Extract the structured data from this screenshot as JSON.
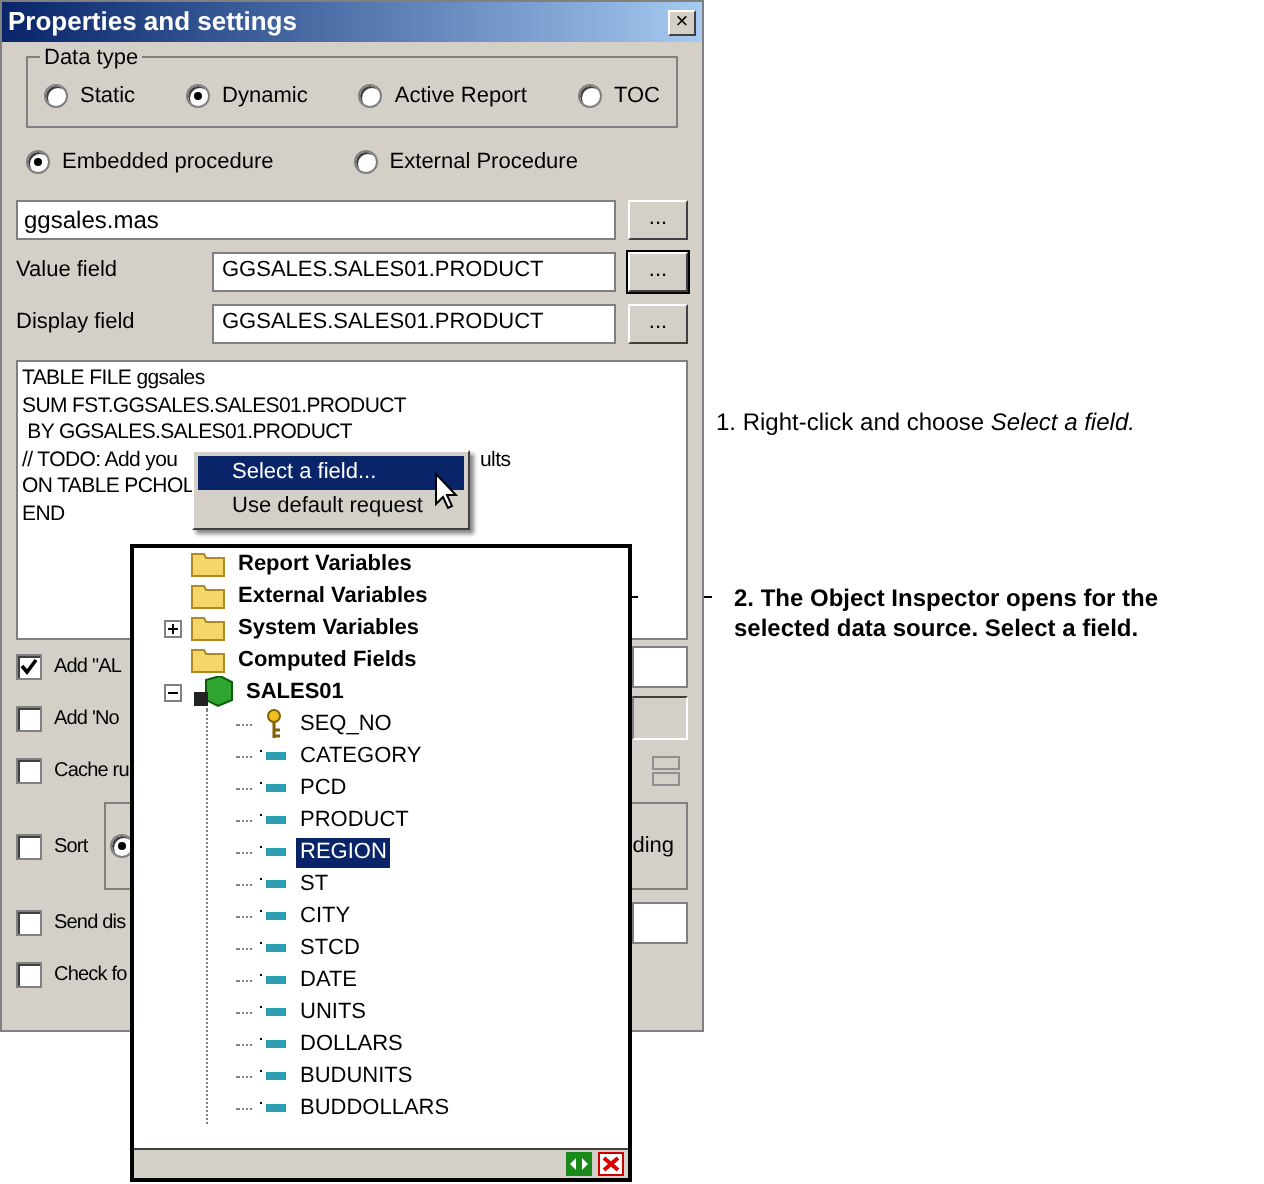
{
  "window": {
    "title": "Properties and settings",
    "close": "×"
  },
  "data_type": {
    "label": "Data type",
    "options": [
      {
        "label": "Static",
        "selected": false
      },
      {
        "label": "Dynamic",
        "selected": true
      },
      {
        "label": "Active Report",
        "selected": false
      },
      {
        "label": "TOC",
        "selected": false
      }
    ]
  },
  "procedure": [
    {
      "label": "Embedded procedure",
      "selected": true
    },
    {
      "label": "External Procedure",
      "selected": false
    }
  ],
  "source": {
    "value": "ggsales.mas",
    "button": "..."
  },
  "fields": [
    {
      "label": "Value field",
      "value": "GGSALES.SALES01.PRODUCT",
      "button": "...",
      "focused": true
    },
    {
      "label": "Display field",
      "value": "GGSALES.SALES01.PRODUCT",
      "button": "...",
      "focused": false
    }
  ],
  "code_lines": [
    {
      "text": "TABLE FILE ggsales"
    },
    {
      "text": "SUM FST.GGSALES.SALES01.PRODUCT"
    },
    {
      "text": " BY GGSALES.SALES01.PRODUCT"
    },
    {
      "text": "// TODO: Add you",
      "tail": "ults"
    },
    {
      "text": "ON TABLE PCHOL"
    },
    {
      "text": "END"
    }
  ],
  "context_menu": [
    {
      "label": "Select a field...",
      "selected": true
    },
    {
      "label": "Use default request",
      "selected": false
    }
  ],
  "options": [
    {
      "kind": "field",
      "label": "Add \"AL",
      "checked": true
    },
    {
      "kind": "panel",
      "label": "Add 'No",
      "checked": false
    },
    {
      "kind": "spin",
      "label": "Cache ru",
      "checked": false
    },
    {
      "kind": "group",
      "label": "Sort",
      "checked": false,
      "radio_selected": true,
      "tail": "ding"
    },
    {
      "kind": "field",
      "label": "Send dis",
      "checked": false
    },
    {
      "kind": "none",
      "label": "Check fo",
      "checked": false
    }
  ],
  "inspector": {
    "tree": [
      {
        "kind": "folder",
        "label": "Report Variables"
      },
      {
        "kind": "folder",
        "label": "External Variables"
      },
      {
        "kind": "folder",
        "label": "System Variables",
        "expanded": false
      },
      {
        "kind": "folder",
        "label": "Computed Fields"
      },
      {
        "kind": "table",
        "label": "SALES01",
        "expanded": true,
        "children": [
          {
            "kind": "key",
            "label": "SEQ_NO",
            "selected": false
          },
          {
            "kind": "field",
            "label": "CATEGORY",
            "selected": false
          },
          {
            "kind": "field",
            "label": "PCD",
            "selected": false
          },
          {
            "kind": "field",
            "label": "PRODUCT",
            "selected": false
          },
          {
            "kind": "field",
            "label": "REGION",
            "selected": true
          },
          {
            "kind": "field",
            "label": "ST",
            "selected": false
          },
          {
            "kind": "field",
            "label": "CITY",
            "selected": false
          },
          {
            "kind": "field",
            "label": "STCD",
            "selected": false
          },
          {
            "kind": "field",
            "label": "DATE",
            "selected": false
          },
          {
            "kind": "field",
            "label": "UNITS",
            "selected": false
          },
          {
            "kind": "field",
            "label": "DOLLARS",
            "selected": false
          },
          {
            "kind": "field",
            "label": "BUDUNITS",
            "selected": false
          },
          {
            "kind": "field",
            "label": "BUDDOLLARS",
            "selected": false
          }
        ]
      }
    ]
  },
  "callouts": [
    "1. Right-click and choose *Select a field.*",
    "2. The Object Inspector opens for the selected data source. Select a field."
  ]
}
